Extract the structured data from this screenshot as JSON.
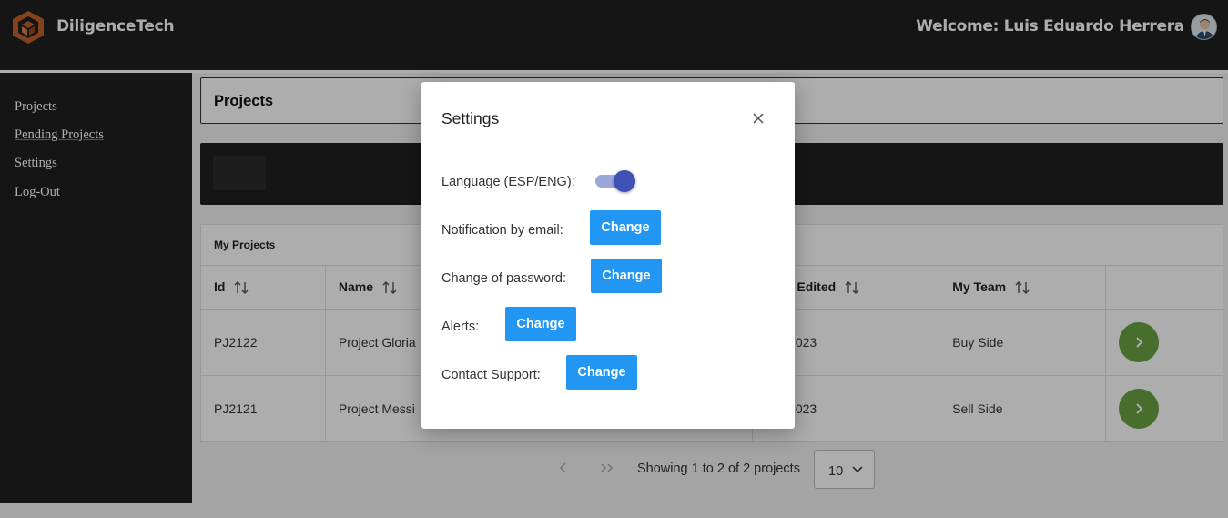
{
  "header": {
    "brand": "DiligenceTech",
    "welcome": "Welcome: Luis Eduardo Herrera"
  },
  "sidebar": {
    "items": [
      {
        "label": "Projects"
      },
      {
        "label": "Pending Projects"
      },
      {
        "label": "Settings"
      },
      {
        "label": "Log-Out"
      }
    ]
  },
  "main": {
    "page_title": "Projects",
    "table_caption": "My Projects",
    "columns": [
      "Id",
      "Name",
      "",
      "Edited",
      "My Team",
      ""
    ],
    "rows": [
      {
        "id": "PJ2122",
        "name": "Project Gloria",
        "edited": "-2023",
        "team": "Buy Side"
      },
      {
        "id": "PJ2121",
        "name": "Project Messi",
        "edited": "-2023",
        "team": "Sell Side"
      }
    ],
    "pagination": {
      "text": "Showing 1 to 2 of 2 projects",
      "page_size": "10"
    }
  },
  "modal": {
    "title": "Settings",
    "language_label": "Language (ESP/ENG):",
    "language_toggle_on": true,
    "settings": [
      {
        "label": "Notification by email:",
        "button": "Change"
      },
      {
        "label": "Change of password:",
        "button": "Change"
      },
      {
        "label": "Alerts:",
        "button": "Change"
      },
      {
        "label": "Contact Support:",
        "button": "Change"
      }
    ]
  },
  "colors": {
    "header_bg": "#1f1f1f",
    "primary_button": "#2196f3",
    "go_button": "#6aa343",
    "toggle_thumb": "#3f51b5",
    "logo": "#c0622b"
  }
}
